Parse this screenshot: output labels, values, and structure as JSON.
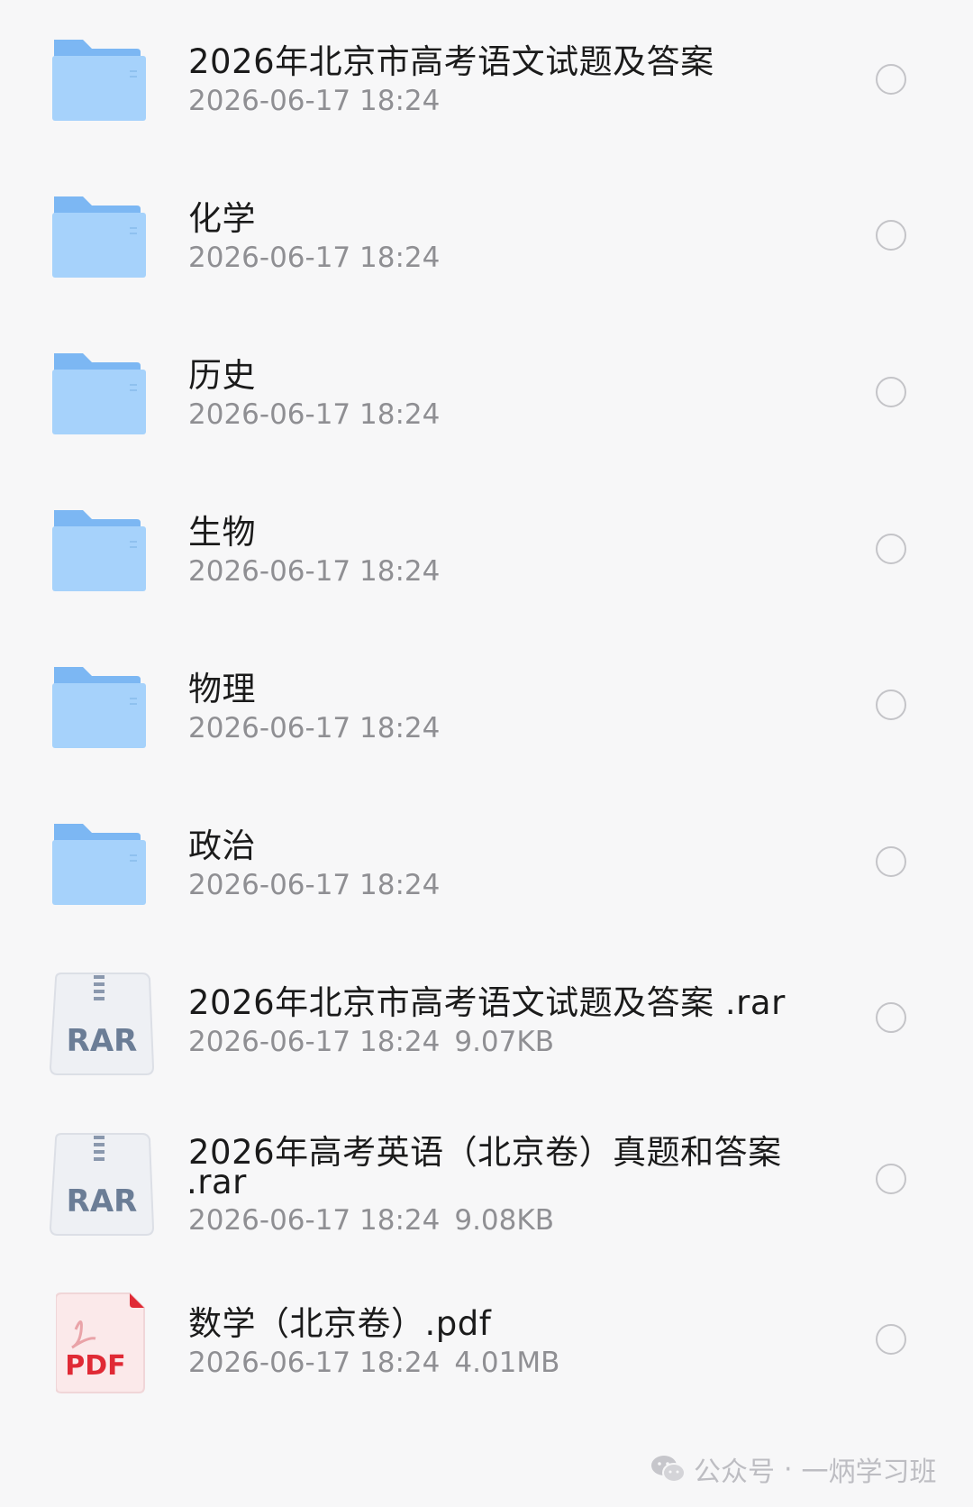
{
  "files": [
    {
      "type": "folder",
      "name": "2026年北京市高考语文试题及答案",
      "date": "2026-06-17 18:24",
      "size": ""
    },
    {
      "type": "folder",
      "name": "化学",
      "date": "2026-06-17 18:24",
      "size": ""
    },
    {
      "type": "folder",
      "name": "历史",
      "date": "2026-06-17 18:24",
      "size": ""
    },
    {
      "type": "folder",
      "name": "生物",
      "date": "2026-06-17 18:24",
      "size": ""
    },
    {
      "type": "folder",
      "name": "物理",
      "date": "2026-06-17 18:24",
      "size": ""
    },
    {
      "type": "folder",
      "name": "政治",
      "date": "2026-06-17 18:24",
      "size": ""
    },
    {
      "type": "rar",
      "icon_label": "RAR",
      "name": "2026年北京市高考语文试题及答案 .rar",
      "date": "2026-06-17 18:24",
      "size": "9.07KB"
    },
    {
      "type": "rar",
      "icon_label": "RAR",
      "name": "2026年高考英语（北京卷）真题和答案",
      "name_line2": ".rar",
      "date": "2026-06-17 18:24",
      "size": "9.08KB"
    },
    {
      "type": "pdf",
      "icon_label": "PDF",
      "name": "数学（北京卷）.pdf",
      "date": "2026-06-17 18:24",
      "size": "4.01MB"
    }
  ],
  "watermark": {
    "icon": "wechat-icon",
    "account_label": "公众号",
    "separator": "·",
    "account_name": "一炳学习班"
  },
  "colors": {
    "folder_light": "#a6d2fb",
    "folder_dark": "#7cb7f3",
    "pdf_red": "#e02a35",
    "rar_text": "#6b7d96"
  }
}
